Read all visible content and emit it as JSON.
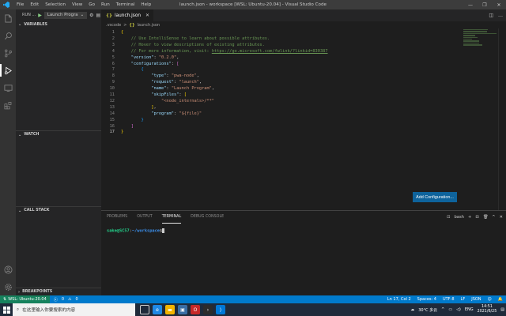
{
  "titlebar": {
    "menu": [
      "File",
      "Edit",
      "Selection",
      "View",
      "Go",
      "Run",
      "Terminal",
      "Help"
    ],
    "title": "launch.json - workspace [WSL: Ubuntu-20.04] - Visual Studio Code",
    "controls": [
      "—",
      "❐",
      "✕"
    ]
  },
  "sidebar": {
    "run_label": "RUN ...",
    "config_select": "Launch Progra",
    "sections": [
      "VARIABLES",
      "WATCH",
      "CALL STACK",
      "BREAKPOINTS"
    ]
  },
  "tabs": [
    {
      "label": "launch.json",
      "icon": "json-braces-icon"
    }
  ],
  "breadcrumb": {
    "folder": ".vscode",
    "sep": ">",
    "file": "launch.json"
  },
  "editor": {
    "current_line": 17,
    "lines": [
      {
        "n": "1",
        "parts": [
          {
            "t": "{",
            "c": "c-brk3"
          }
        ]
      },
      {
        "n": "2",
        "parts": [
          {
            "t": "    // Use IntelliSense to learn about possible attributes.",
            "c": "c-com"
          }
        ]
      },
      {
        "n": "3",
        "parts": [
          {
            "t": "    // Hover to view descriptions of existing attributes.",
            "c": "c-com"
          }
        ]
      },
      {
        "n": "4",
        "parts": [
          {
            "t": "    // For more information, visit: ",
            "c": "c-com"
          },
          {
            "t": "https://go.microsoft.com/fwlink/?linkid=830387",
            "c": "c-link"
          }
        ]
      },
      {
        "n": "5",
        "parts": [
          {
            "t": "    ",
            "c": "c-text"
          },
          {
            "t": "\"version\"",
            "c": "c-key"
          },
          {
            "t": ": ",
            "c": "c-pun"
          },
          {
            "t": "\"0.2.0\"",
            "c": "c-str"
          },
          {
            "t": ",",
            "c": "c-pun"
          }
        ]
      },
      {
        "n": "6",
        "parts": [
          {
            "t": "    ",
            "c": "c-text"
          },
          {
            "t": "\"configurations\"",
            "c": "c-key"
          },
          {
            "t": ": ",
            "c": "c-pun"
          },
          {
            "t": "[",
            "c": "c-brk"
          }
        ]
      },
      {
        "n": "7",
        "parts": [
          {
            "t": "        {",
            "c": "c-brk2"
          }
        ]
      },
      {
        "n": "8",
        "parts": [
          {
            "t": "            ",
            "c": "c-text"
          },
          {
            "t": "\"type\"",
            "c": "c-key"
          },
          {
            "t": ": ",
            "c": "c-pun"
          },
          {
            "t": "\"pwa-node\"",
            "c": "c-str"
          },
          {
            "t": ",",
            "c": "c-pun"
          }
        ]
      },
      {
        "n": "9",
        "parts": [
          {
            "t": "            ",
            "c": "c-text"
          },
          {
            "t": "\"request\"",
            "c": "c-key"
          },
          {
            "t": ": ",
            "c": "c-pun"
          },
          {
            "t": "\"launch\"",
            "c": "c-str"
          },
          {
            "t": ",",
            "c": "c-pun"
          }
        ]
      },
      {
        "n": "10",
        "parts": [
          {
            "t": "            ",
            "c": "c-text"
          },
          {
            "t": "\"name\"",
            "c": "c-key"
          },
          {
            "t": ": ",
            "c": "c-pun"
          },
          {
            "t": "\"Launch Program\"",
            "c": "c-str"
          },
          {
            "t": ",",
            "c": "c-pun"
          }
        ]
      },
      {
        "n": "11",
        "parts": [
          {
            "t": "            ",
            "c": "c-text"
          },
          {
            "t": "\"skipFiles\"",
            "c": "c-key"
          },
          {
            "t": ": ",
            "c": "c-pun"
          },
          {
            "t": "[",
            "c": "c-brk3"
          }
        ]
      },
      {
        "n": "12",
        "parts": [
          {
            "t": "                ",
            "c": "c-text"
          },
          {
            "t": "\"<node_internals>/**\"",
            "c": "c-str"
          }
        ]
      },
      {
        "n": "13",
        "parts": [
          {
            "t": "            ",
            "c": "c-text"
          },
          {
            "t": "]",
            "c": "c-brk3"
          },
          {
            "t": ",",
            "c": "c-pun"
          }
        ]
      },
      {
        "n": "14",
        "parts": [
          {
            "t": "            ",
            "c": "c-text"
          },
          {
            "t": "\"program\"",
            "c": "c-key"
          },
          {
            "t": ": ",
            "c": "c-pun"
          },
          {
            "t": "\"${file}\"",
            "c": "c-str"
          }
        ]
      },
      {
        "n": "15",
        "parts": [
          {
            "t": "        }",
            "c": "c-brk2"
          }
        ]
      },
      {
        "n": "16",
        "parts": [
          {
            "t": "    ]",
            "c": "c-brk"
          }
        ]
      },
      {
        "n": "17",
        "parts": [
          {
            "t": "}",
            "c": "c-brk3"
          }
        ]
      }
    ],
    "add_config_button": "Add Configuration..."
  },
  "panel": {
    "tabs": [
      "PROBLEMS",
      "OUTPUT",
      "TERMINAL",
      "DEBUG CONSOLE"
    ],
    "active_tab": "TERMINAL",
    "shell": "bash",
    "actions": [
      "+",
      "⊟",
      "🗑",
      "^",
      "✕"
    ],
    "terminal": {
      "user": "sake@SC57",
      "sep": ":",
      "path": "~/workspace",
      "prompt": "$"
    }
  },
  "statusbar": {
    "remote": "WSL: Ubuntu-20.04",
    "errors": "0",
    "warnings": "0",
    "right": [
      "Ln 17, Col 2",
      "Spaces: 4",
      "UTF-8",
      "LF",
      "JSON"
    ]
  },
  "taskbar": {
    "search_placeholder": "在这里输入你要搜索的内容",
    "weather": "30°C 多云",
    "lang": "ENG",
    "time": "14:51",
    "date": "2021/6/25"
  },
  "colors": {
    "accent": "#007acc",
    "remote": "#16825d",
    "button": "#0e639c"
  }
}
